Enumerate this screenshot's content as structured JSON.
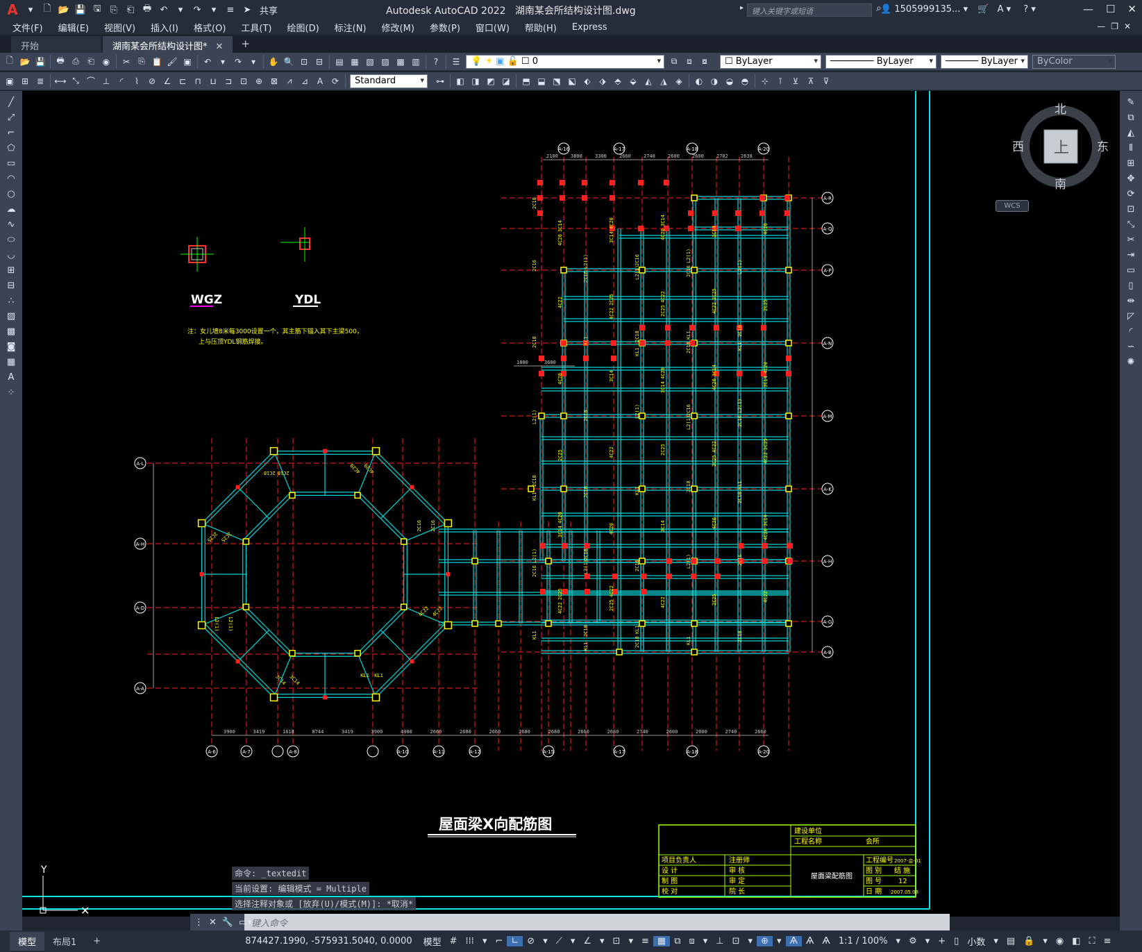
{
  "app": {
    "title": "Autodesk AutoCAD 2022",
    "file": "湖南某会所结构设计图.dwg",
    "share_label": "共享",
    "search_placeholder": "键入关键字或短语",
    "user": "1505999135...",
    "logo": "A"
  },
  "menu": [
    "文件(F)",
    "编辑(E)",
    "视图(V)",
    "插入(I)",
    "格式(O)",
    "工具(T)",
    "绘图(D)",
    "标注(N)",
    "修改(M)",
    "参数(P)",
    "窗口(W)",
    "帮助(H)",
    "Express"
  ],
  "tabs": [
    {
      "label": "开始"
    },
    {
      "label": "湖南某会所结构设计图*"
    }
  ],
  "toolbar": {
    "layer_value": "0",
    "color_value": "ByLayer",
    "linetype_value": "ByLayer",
    "lineweight_value": "ByLayer",
    "plotstyle_value": "ByColor",
    "textstyle_value": "Standard"
  },
  "viewcube": {
    "north": "北",
    "south": "南",
    "east": "东",
    "west": "西",
    "top": "上",
    "wcs": "WCS"
  },
  "drawing": {
    "title": "屋面梁X向配筋图",
    "detail1": "WGZ",
    "detail2": "YDL",
    "note_line1": "注：女儿墙8米每3000设置一个，其主筋下锚入其下主梁500，",
    "note_line2": "上与压顶YDL钢筋焊接。",
    "titleblock": {
      "build_unit": "建设单位",
      "project_name": "工程名称",
      "project_value": "会所",
      "pm": "项目负责人",
      "registered": "注册师",
      "design": "设 计",
      "check": "审 核",
      "draw": "制 图",
      "approve": "审 定",
      "proof": "校 对",
      "chief": "院 长",
      "drawing_name": "屋面梁配筋图",
      "proj_no_label": "工程编号",
      "proj_no": "2007-会-01",
      "category_label": "图 别",
      "category": "结 施",
      "sheet_label": "图 号",
      "sheet": "12",
      "date_label": "日 期",
      "date": "2007.05.08"
    },
    "axis_top": [
      "A-16",
      "A-17",
      "A-18",
      "A-20"
    ],
    "axis_bottom": [
      "A-6",
      "A-7",
      "",
      "A-8",
      "",
      "A-10",
      "A-11",
      "A-12",
      "A-15",
      "A-17",
      "A-18",
      "A-20"
    ],
    "axis_right": [
      "A-R",
      "A-Q",
      "A-P",
      "A-N",
      "A-M",
      "A-K",
      "A-H",
      "A-G",
      "A-B"
    ],
    "axis_left": [
      "A-L",
      "A-H",
      "A-D",
      "A-A"
    ],
    "dims_top": [
      "2100",
      "3800",
      "3300",
      "2660",
      "2740",
      "2600",
      "2600",
      "2702",
      "2638"
    ],
    "dims_bottom": [
      "3900",
      "3419",
      "1618",
      "8744",
      "3419",
      "3900",
      "4000",
      "2660",
      "2680",
      "2660",
      "2680",
      "2680",
      "2660",
      "2680",
      "2740",
      "2600",
      "2600",
      "2740",
      "2660"
    ],
    "dims_mid": [
      "1800",
      "3600"
    ]
  },
  "command": {
    "history": [
      "命令: _textedit",
      "当前设置: 编辑模式 = Multiple",
      "选择注释对象或 [放弃(U)/模式(M)]: *取消*"
    ],
    "placeholder": "键入命令"
  },
  "status": {
    "tab_model": "模型",
    "tab_layout": "布局1",
    "coords": "874427.1990, -575931.5040, 0.0000",
    "mode": "模型",
    "scale": "1:1 / 100%",
    "units": "小数"
  }
}
